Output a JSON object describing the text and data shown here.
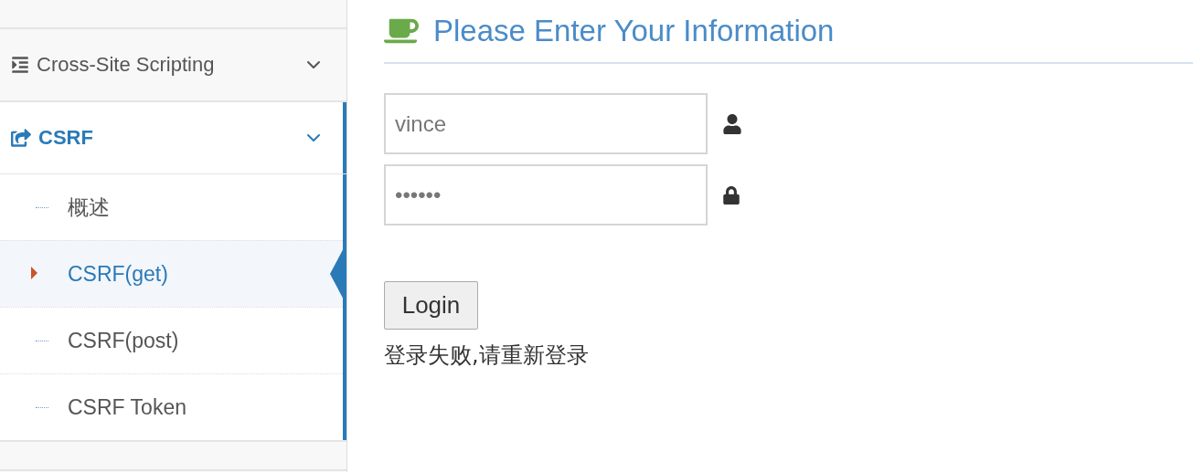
{
  "sidebar": {
    "groups": [
      {
        "label": "Cross-Site Scripting",
        "kind": "indent",
        "selected": false
      },
      {
        "label": "CSRF",
        "kind": "share",
        "selected": true,
        "items": [
          {
            "label": "概述",
            "selected": false
          },
          {
            "label": "CSRF(get)",
            "selected": true
          },
          {
            "label": "CSRF(post)",
            "selected": false
          },
          {
            "label": "CSRF Token",
            "selected": false
          }
        ]
      }
    ]
  },
  "form": {
    "title": "Please Enter Your Information",
    "fields": [
      {
        "kind": "user",
        "value": "vince"
      },
      {
        "kind": "lock",
        "value": "••••••"
      }
    ],
    "button": "Login",
    "message": "登录失败,请重新登录"
  }
}
